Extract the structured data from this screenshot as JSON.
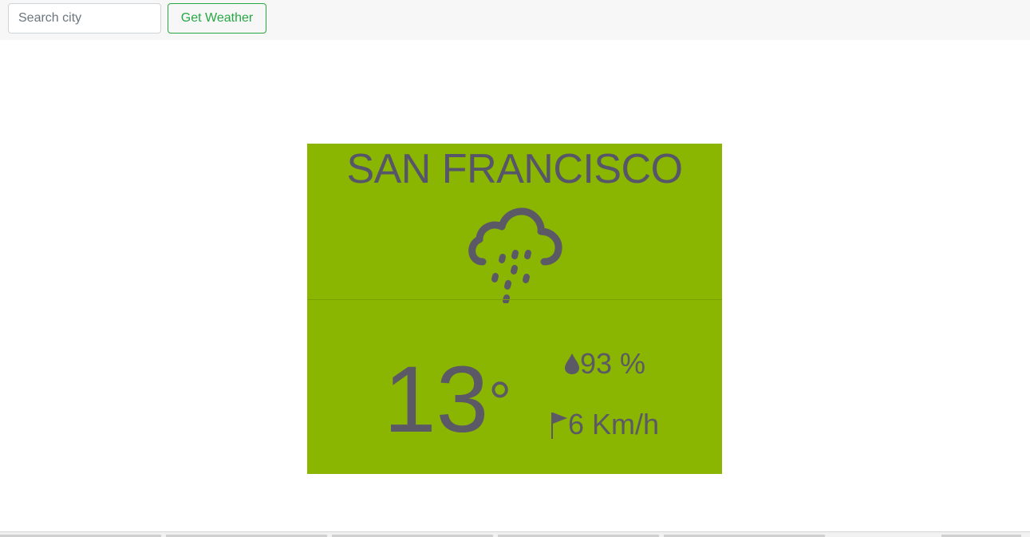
{
  "search": {
    "placeholder": "Search city",
    "value": ""
  },
  "actions": {
    "get_weather_label": "Get Weather"
  },
  "weather": {
    "city": "SAN FRANCISCO",
    "condition_icon": "cloud-rain-icon",
    "temperature": "13",
    "degree_symbol": "°",
    "humidity": "93 %",
    "humidity_icon": "droplet-icon",
    "wind": "6 Km/h",
    "wind_icon": "flag-icon"
  },
  "colors": {
    "card_background": "#8ab500",
    "text": "#5c5966",
    "button_accent": "#28a745",
    "topbar_background": "#f7f7f7"
  }
}
